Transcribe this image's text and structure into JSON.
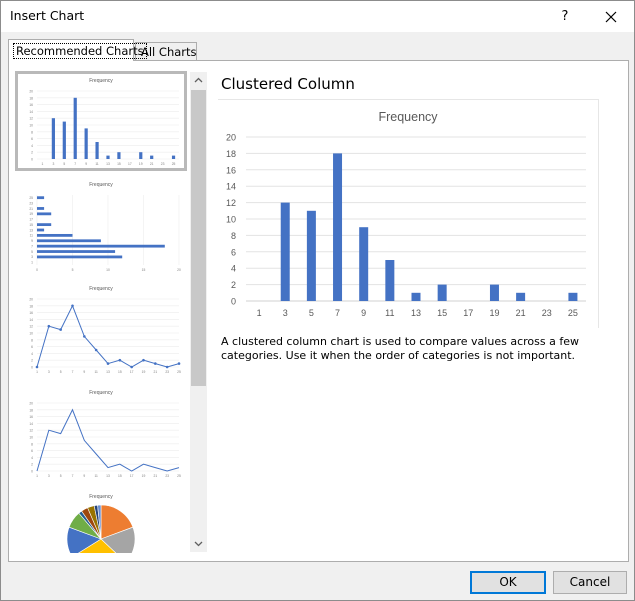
{
  "window": {
    "title": "Insert Chart",
    "help": "?"
  },
  "tabs": [
    {
      "label": "Recommended Charts",
      "selected": true
    },
    {
      "label": "All Charts",
      "selected": false
    }
  ],
  "thumbnails": [
    {
      "kind": "clustered-column",
      "title": "Frequency",
      "selected": true
    },
    {
      "kind": "clustered-bar",
      "title": "Frequency",
      "selected": false
    },
    {
      "kind": "scatter-lines",
      "title": "Frequency",
      "selected": false
    },
    {
      "kind": "line",
      "title": "Frequency",
      "selected": false
    },
    {
      "kind": "pie",
      "title": "Frequency",
      "selected": false
    }
  ],
  "preview": {
    "chart_type_name": "Clustered Column",
    "description": "A clustered column chart is used to compare values across a few categories. Use it when the order of categories is not important."
  },
  "chart_data": {
    "type": "bar",
    "title": "Frequency",
    "categories": [
      "1",
      "3",
      "5",
      "7",
      "9",
      "11",
      "13",
      "15",
      "17",
      "19",
      "21",
      "23",
      "25"
    ],
    "values": [
      0,
      12,
      11,
      18,
      9,
      5,
      1,
      2,
      0,
      2,
      1,
      0,
      1
    ],
    "ylim": [
      0,
      20
    ],
    "yticks": [
      0,
      2,
      4,
      6,
      8,
      10,
      12,
      14,
      16,
      18,
      20
    ],
    "xlabel": "",
    "ylabel": "",
    "grid": true,
    "legend": "none",
    "color": "#4472c4"
  },
  "buttons": {
    "ok": "OK",
    "cancel": "Cancel"
  },
  "colors": {
    "accent": "#0078d7",
    "series": "#4472c4"
  }
}
